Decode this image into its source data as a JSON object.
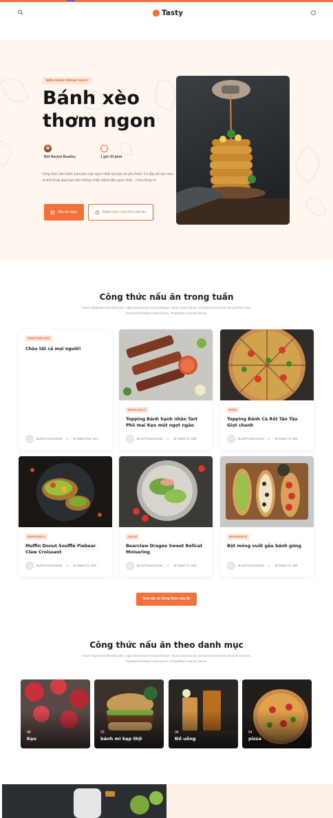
{
  "brand": {
    "name": "Tasty",
    "accent": "#f4713b",
    "tint": "#fff6f0"
  },
  "header": {
    "search_icon": "search-icon",
    "user_icon": "user-icon"
  },
  "hero": {
    "badge": "BIẾN NHÂN TRONG NGÀY",
    "title": "Bánh xèo thơm ngon",
    "author": "Bởi Rachel Bradley",
    "time": "1 giờ 30 phút",
    "description": "Công thức làm bánh pancake xốp ngon nhất mà bạn sẽ yêu thích. Có đầy đủ các mẹo và thủ thuật giúp bạn làm những chiếc bánh kếp ngon nhất... chưa từng có",
    "primary_button": "Nấu ăn ngay",
    "secondary_button": "Khám phá công thức nấu ăn"
  },
  "weekly": {
    "title": "Công thức nấu ăn trong tuần",
    "subtitle": "Fusce dignissim blandit justo, eget elementum risus tristique. Nunc lacus lacus, sit amet accumsan est pulvinar non. Praesent tristique enim lorem. Phasellus a auctor lacus.",
    "cards": [
      {
        "tag": "CHÀO PHẦN 2024",
        "title": "Chào tất cả mọi người!",
        "author": "",
        "date": ""
      },
      {
        "tag": "MUỐN KHÁ VỊ",
        "title": "Topping Bánh hạnh nhân Tart Phô mai Kẹo mút ngọt ngào",
        "author": "BLOGFYCHILD NGON",
        "date": "18 THÁNG TƯ, 2021"
      },
      {
        "tag": "PIZZA",
        "title": "Topping Bánh Cà Rốt Táo Tàu Giọt chanh",
        "author": "BLOGFYCHILD NGON",
        "date": "18 THÁNG TƯ, 2021"
      },
      {
        "tag": "MUỐN KHÁ VỊ",
        "title": "Muffin Donut Soufflé Piebear Claw Croissant",
        "author": "BLOGFYCHILD NGON",
        "date": "18 THÁNG TƯ, 2021"
      },
      {
        "tag": "SALAD",
        "title": "Bearclaw Dragée Sweet Rollcat Moisering",
        "author": "BLOGFYCHILD NGON",
        "date": "18 THÁNG TƯ, 2021"
      },
      {
        "tag": "MUỐN KHÁ VỊ",
        "title": "Bột mông vuốt gấu bánh gừng",
        "author": "BLOGFYCHILD NGON",
        "date": "18 THÁNG TƯ, 2021"
      }
    ],
    "first_card_date": "29 THÁNG TÁM, 2021",
    "first_card_author": "BLOGFYCHILD NGON",
    "view_all": "Xem tất cả Công thức nấu ăn"
  },
  "categories": {
    "title": "Công thức nấu ăn theo danh mục",
    "subtitle": "Fusce dignissim blandit justo, eget elementum risus tristique. Nunc lacus lacus, sit amet accumsan est pulvinar non. Praesent tristique enim lorem. Phasellus a auctor lacus.",
    "items": [
      {
        "count": "98",
        "name": "Kẹo"
      },
      {
        "count": "23",
        "name": "bánh mì kẹp thịt"
      },
      {
        "count": "34",
        "name": "Đồ uống"
      },
      {
        "count": "54",
        "name": "pizza"
      }
    ]
  }
}
